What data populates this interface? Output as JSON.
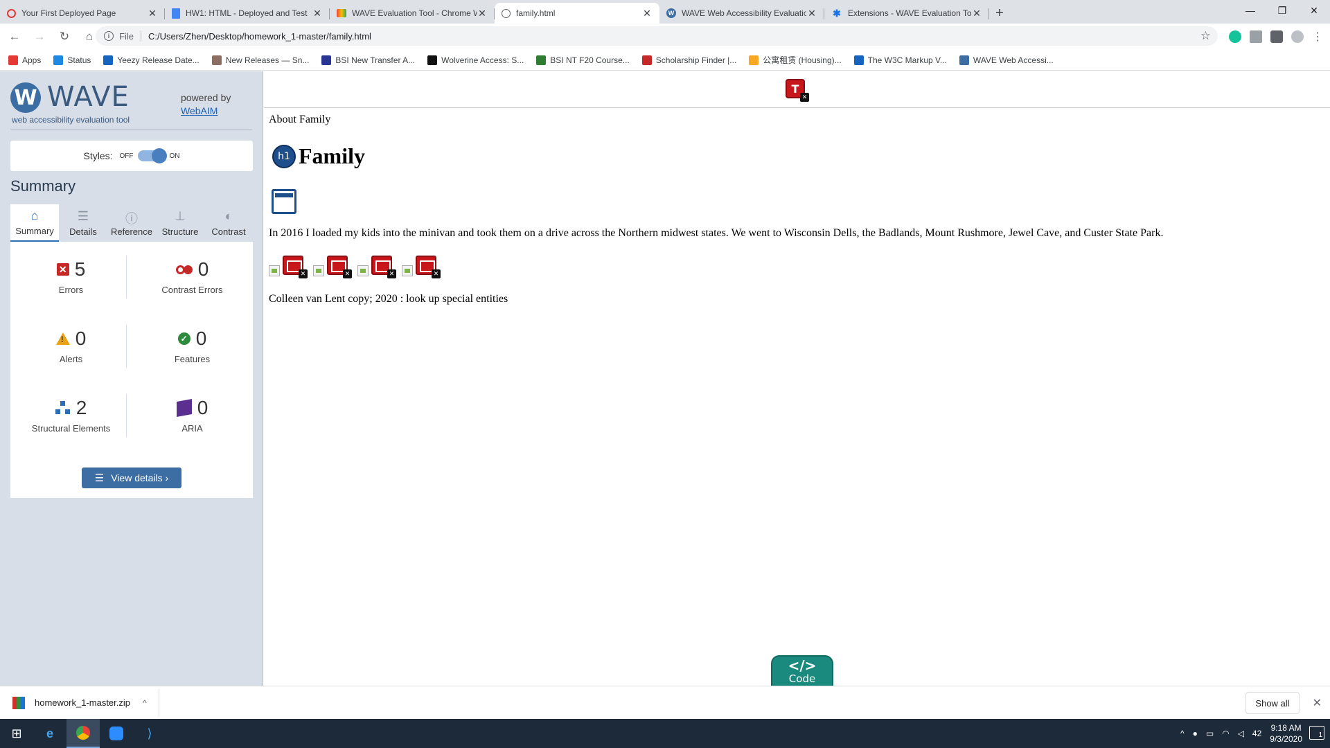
{
  "browser": {
    "tabs": [
      {
        "title": "Your First Deployed Page",
        "icon": "loading-ring-icon"
      },
      {
        "title": "HW1: HTML - Deployed and Test",
        "icon": "google-docs-icon"
      },
      {
        "title": "WAVE Evaluation Tool - Chrome W",
        "icon": "chrome-webstore-icon"
      },
      {
        "title": "family.html",
        "icon": "globe-icon"
      },
      {
        "title": "WAVE Web Accessibility Evaluatio",
        "icon": "wave-icon"
      },
      {
        "title": "Extensions - WAVE Evaluation To",
        "icon": "puzzle-icon"
      }
    ],
    "active_tab": 3,
    "address": {
      "scheme": "File",
      "url": "C:/Users/Zhen/Desktop/homework_1-master/family.html"
    },
    "bookmarks": [
      {
        "label": "Apps",
        "color": "#e53935"
      },
      {
        "label": "Status",
        "color": "#1e88e5"
      },
      {
        "label": "Yeezy Release Date...",
        "color": "#1565c0"
      },
      {
        "label": "New Releases — Sn...",
        "color": "#8d6e63"
      },
      {
        "label": "BSI New Transfer A...",
        "color": "#283593"
      },
      {
        "label": "Wolverine Access: S...",
        "color": "#111111"
      },
      {
        "label": "BSI NT F20 Course...",
        "color": "#2e7d32"
      },
      {
        "label": "Scholarship Finder |...",
        "color": "#c62828"
      },
      {
        "label": "公寓租赁 (Housing)...",
        "color": "#f9a825"
      },
      {
        "label": "The W3C Markup V...",
        "color": "#1565c0"
      },
      {
        "label": "WAVE Web Accessi...",
        "color": "#3c6ea3"
      }
    ]
  },
  "wave": {
    "logo_text": "WAVE",
    "subtitle": "web accessibility evaluation tool",
    "powered_by": "powered by",
    "webaim": "WebAIM",
    "styles_label": "Styles:",
    "styles_off": "OFF",
    "styles_on": "ON",
    "summary_title": "Summary",
    "tabs": [
      "Summary",
      "Details",
      "Reference",
      "Structure",
      "Contrast"
    ],
    "stats": {
      "errors": {
        "value": "5",
        "label": "Errors"
      },
      "contrast": {
        "value": "0",
        "label": "Contrast Errors"
      },
      "alerts": {
        "value": "0",
        "label": "Alerts"
      },
      "features": {
        "value": "0",
        "label": "Features"
      },
      "structure": {
        "value": "2",
        "label": "Structural Elements"
      },
      "aria": {
        "value": "0",
        "label": "ARIA"
      }
    },
    "view_details": "View details ›"
  },
  "page": {
    "title_line": "About Family",
    "heading": "Family",
    "h1_badge": "h1",
    "paragraph": "In 2016 I loaded my kids into the minivan and took them on a drive across the Northern midwest states. We went to Wisconsin Dells, the Badlands, Mount Rushmore, Jewel Cave, and Custer State Park.",
    "footer": "Colleen van Lent copy; 2020 : look up special entities",
    "code_label": "Code"
  },
  "downloads": {
    "file": "homework_1-master.zip",
    "show_all": "Show all"
  },
  "taskbar": {
    "time": "9:18 AM",
    "date": "9/3/2020",
    "notifications": "1",
    "tray_temp": "42"
  }
}
